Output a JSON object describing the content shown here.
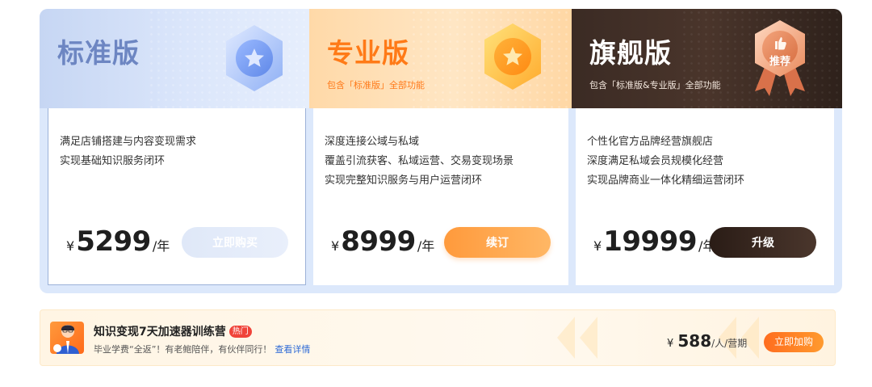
{
  "plans": [
    {
      "title": "标准版",
      "subtitle": "",
      "badge_icon": "star-hexagon-icon",
      "features": [
        "满足店铺搭建与内容变现需求",
        "实现基础知识服务闭环"
      ],
      "currency": "¥",
      "price": "5299",
      "unit": "/年",
      "button_label": "立即购买",
      "accent": "#6d86c2"
    },
    {
      "title": "专业版",
      "subtitle": "包含「标准版」全部功能",
      "badge_icon": "star-hexagon-icon",
      "features": [
        "深度连接公域与私域",
        "覆盖引流获客、私域运营、交易变现场景",
        "实现完整知识服务与用户运营闭环"
      ],
      "currency": "¥",
      "price": "8999",
      "unit": "/年",
      "button_label": "续订",
      "accent": "#ff7a17"
    },
    {
      "title": "旗舰版",
      "subtitle": "包含「标准版&专业版」全部功能",
      "badge_icon": "thumbs-up-ribbon-icon",
      "badge_text": "推荐",
      "features": [
        "个性化官方品牌经营旗舰店",
        "深度满足私域会员规模化经营",
        "实现品牌商业一体化精细运营闭环"
      ],
      "currency": "¥",
      "price": "19999",
      "unit": "/年",
      "button_label": "升级",
      "accent": "#3b2b24"
    }
  ],
  "camp": {
    "avatar_icon": "tutor-avatar-icon",
    "title": "知识变现7天加速器训练营",
    "hot_tag": "热门",
    "description": "毕业学费“全返”！有老鲍陪伴，有伙伴同行！",
    "link_label": "查看详情",
    "currency": "¥",
    "price": "588",
    "unit": "/人/营期",
    "button_label": "立即加购"
  }
}
